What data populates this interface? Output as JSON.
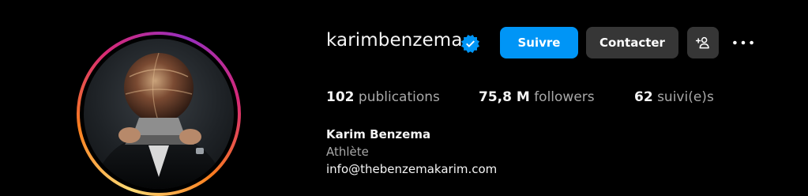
{
  "profile": {
    "username": "karimbenzema",
    "verified": true,
    "avatar_icon": "profile-photo-ballon-dor"
  },
  "actions": {
    "follow_label": "Suivre",
    "contact_label": "Contacter",
    "add_user_icon": "add-user-icon",
    "more_icon": "more-options-icon"
  },
  "stats": {
    "posts_count": "102",
    "posts_label": "publications",
    "followers_count": "75,8 M",
    "followers_label": "followers",
    "following_count": "62",
    "following_label": "suivi(e)s"
  },
  "bio": {
    "full_name": "Karim Benzema",
    "category": "Athlète",
    "email": "info@thebenzemakarim.com"
  },
  "colors": {
    "background": "#000000",
    "primary_button": "#0095f6",
    "secondary_button": "#363636",
    "verified_badge": "#0095f6",
    "muted_text": "#a8a8a8",
    "text": "#f5f5f5"
  }
}
